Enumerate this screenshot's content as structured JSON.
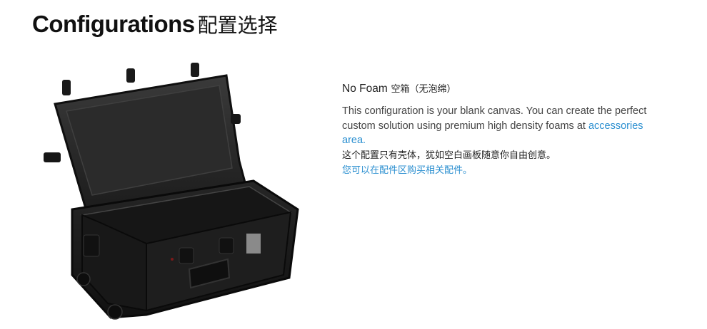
{
  "header": {
    "title_en": "Configurations",
    "title_zh": "配置选择"
  },
  "product": {
    "image_label": "black protective case, lid open, empty interior"
  },
  "config": {
    "heading_en": "No Foam",
    "heading_zh": "空箱（无泡绵）",
    "description_en": "This configuration is your blank canvas. You can create the perfect custom solution using premium high density foams at ",
    "link_en": "accessories area.",
    "description_zh": "这个配置只有壳体，犹如空白画板随意你自由创意。",
    "link_zh": "您可以在配件区购买相关配件。"
  },
  "colors": {
    "link": "#2b8fd0",
    "title": "#111111"
  }
}
